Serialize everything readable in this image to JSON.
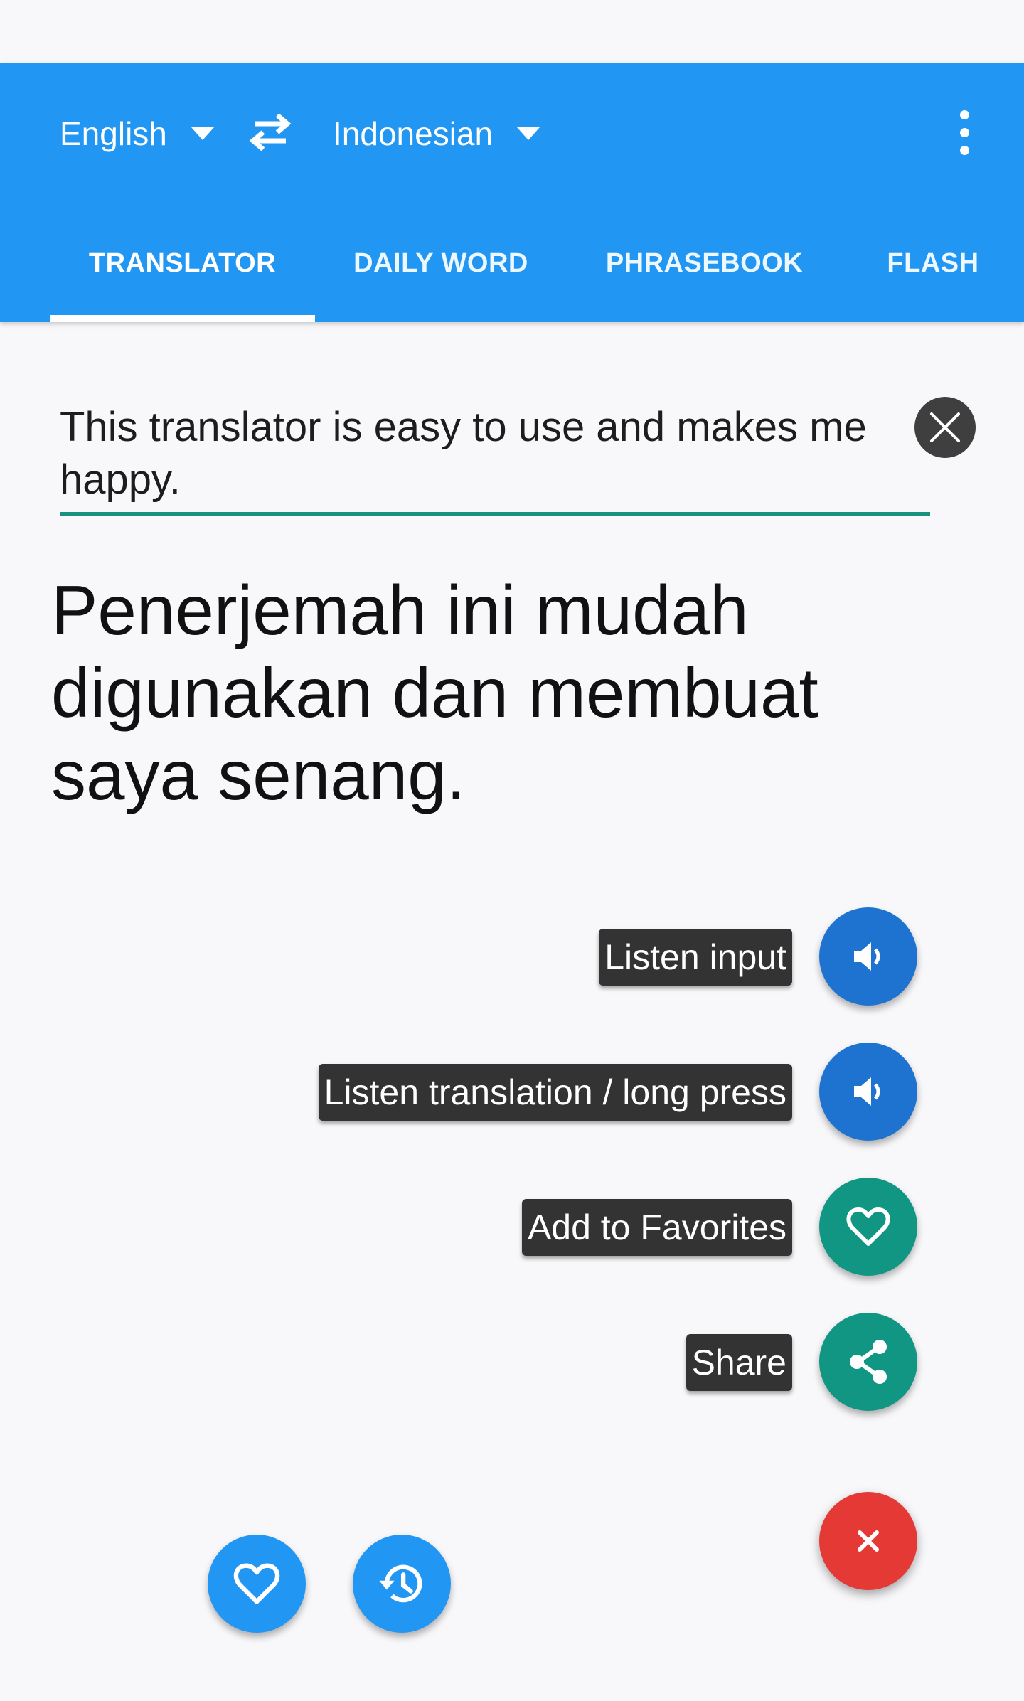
{
  "header": {
    "source_language": "English",
    "target_language": "Indonesian",
    "accent_color": "#2196f3"
  },
  "tabs": [
    {
      "label": "TRANSLATOR",
      "selected": true
    },
    {
      "label": "DAILY WORD",
      "selected": false
    },
    {
      "label": "PHRASEBOOK",
      "selected": false
    },
    {
      "label": "FLASH",
      "selected": false
    }
  ],
  "translator": {
    "input_text": "This translator is easy to use and makes me happy.",
    "output_text": "Penerjemah ini mudah digunakan dan membuat saya senang."
  },
  "fab_menu": [
    {
      "label": "Listen input",
      "icon": "speaker-icon",
      "color": "#1e73d1"
    },
    {
      "label": "Listen translation / long press",
      "icon": "speaker-icon",
      "color": "#1e73d1"
    },
    {
      "label": "Add to Favorites",
      "icon": "heart-outline-icon",
      "color": "#119683"
    },
    {
      "label": "Share",
      "icon": "share-icon",
      "color": "#119683"
    }
  ],
  "fab_close": {
    "icon": "close-icon",
    "color": "#e53935"
  },
  "bottom_buttons": [
    {
      "icon": "heart-outline-icon"
    },
    {
      "icon": "history-icon"
    }
  ]
}
